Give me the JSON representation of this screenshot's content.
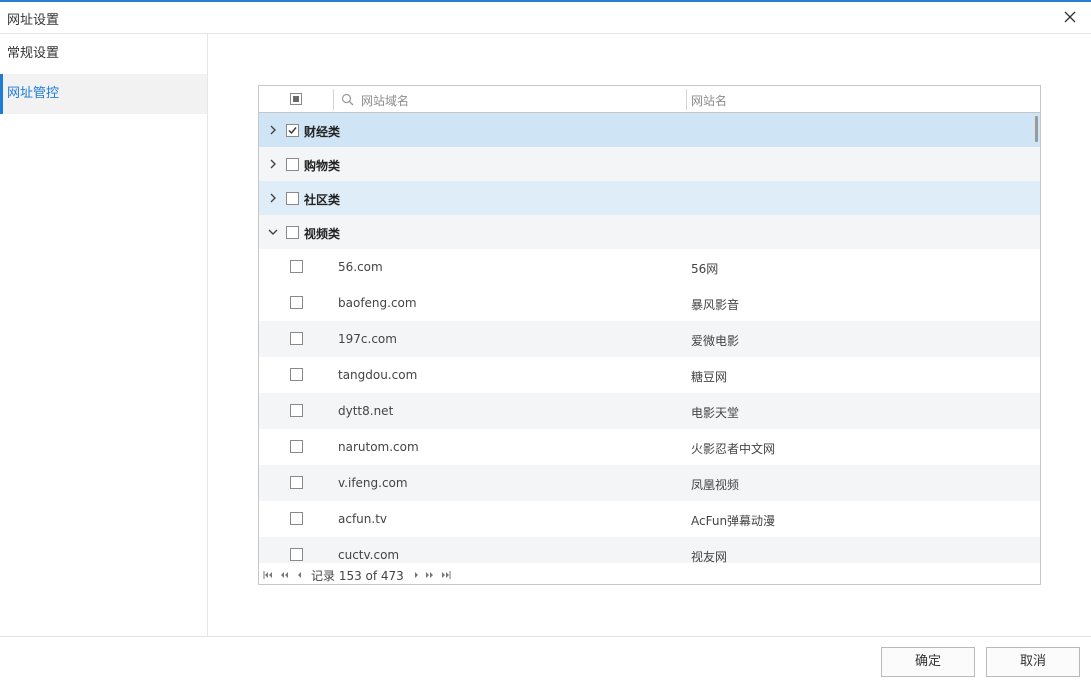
{
  "window": {
    "title": "网址设置"
  },
  "sidebar": {
    "items": [
      {
        "label": "常规设置",
        "active": false
      },
      {
        "label": "网址管控",
        "active": true
      }
    ]
  },
  "grid": {
    "header": {
      "domain_placeholder": "网站域名",
      "name_label": "网站名"
    },
    "categories": [
      {
        "label": "财经类",
        "checked": true,
        "expanded": false
      },
      {
        "label": "购物类",
        "checked": false,
        "expanded": false
      },
      {
        "label": "社区类",
        "checked": false,
        "expanded": false
      },
      {
        "label": "视频类",
        "checked": false,
        "expanded": true
      }
    ],
    "children": [
      {
        "domain": "56.com",
        "name": "56网"
      },
      {
        "domain": "baofeng.com",
        "name": "暴风影音"
      },
      {
        "domain": "197c.com",
        "name": "爱微电影"
      },
      {
        "domain": "tangdou.com",
        "name": "糖豆网"
      },
      {
        "domain": "dytt8.net",
        "name": "电影天堂"
      },
      {
        "domain": "narutom.com",
        "name": "火影忍者中文网"
      },
      {
        "domain": "v.ifeng.com",
        "name": "凤凰视频"
      },
      {
        "domain": "acfun.tv",
        "name": "AcFun弹幕动漫"
      },
      {
        "domain": "cuctv.com",
        "name": "视友网"
      }
    ],
    "pager": {
      "text": "记录 153 of 473"
    }
  },
  "footer": {
    "ok_label": "确定",
    "cancel_label": "取消"
  },
  "colors": {
    "accent": "#1e7bd6",
    "selected_row": "#cfe4f5",
    "alt_row": "#f4f5f7"
  }
}
